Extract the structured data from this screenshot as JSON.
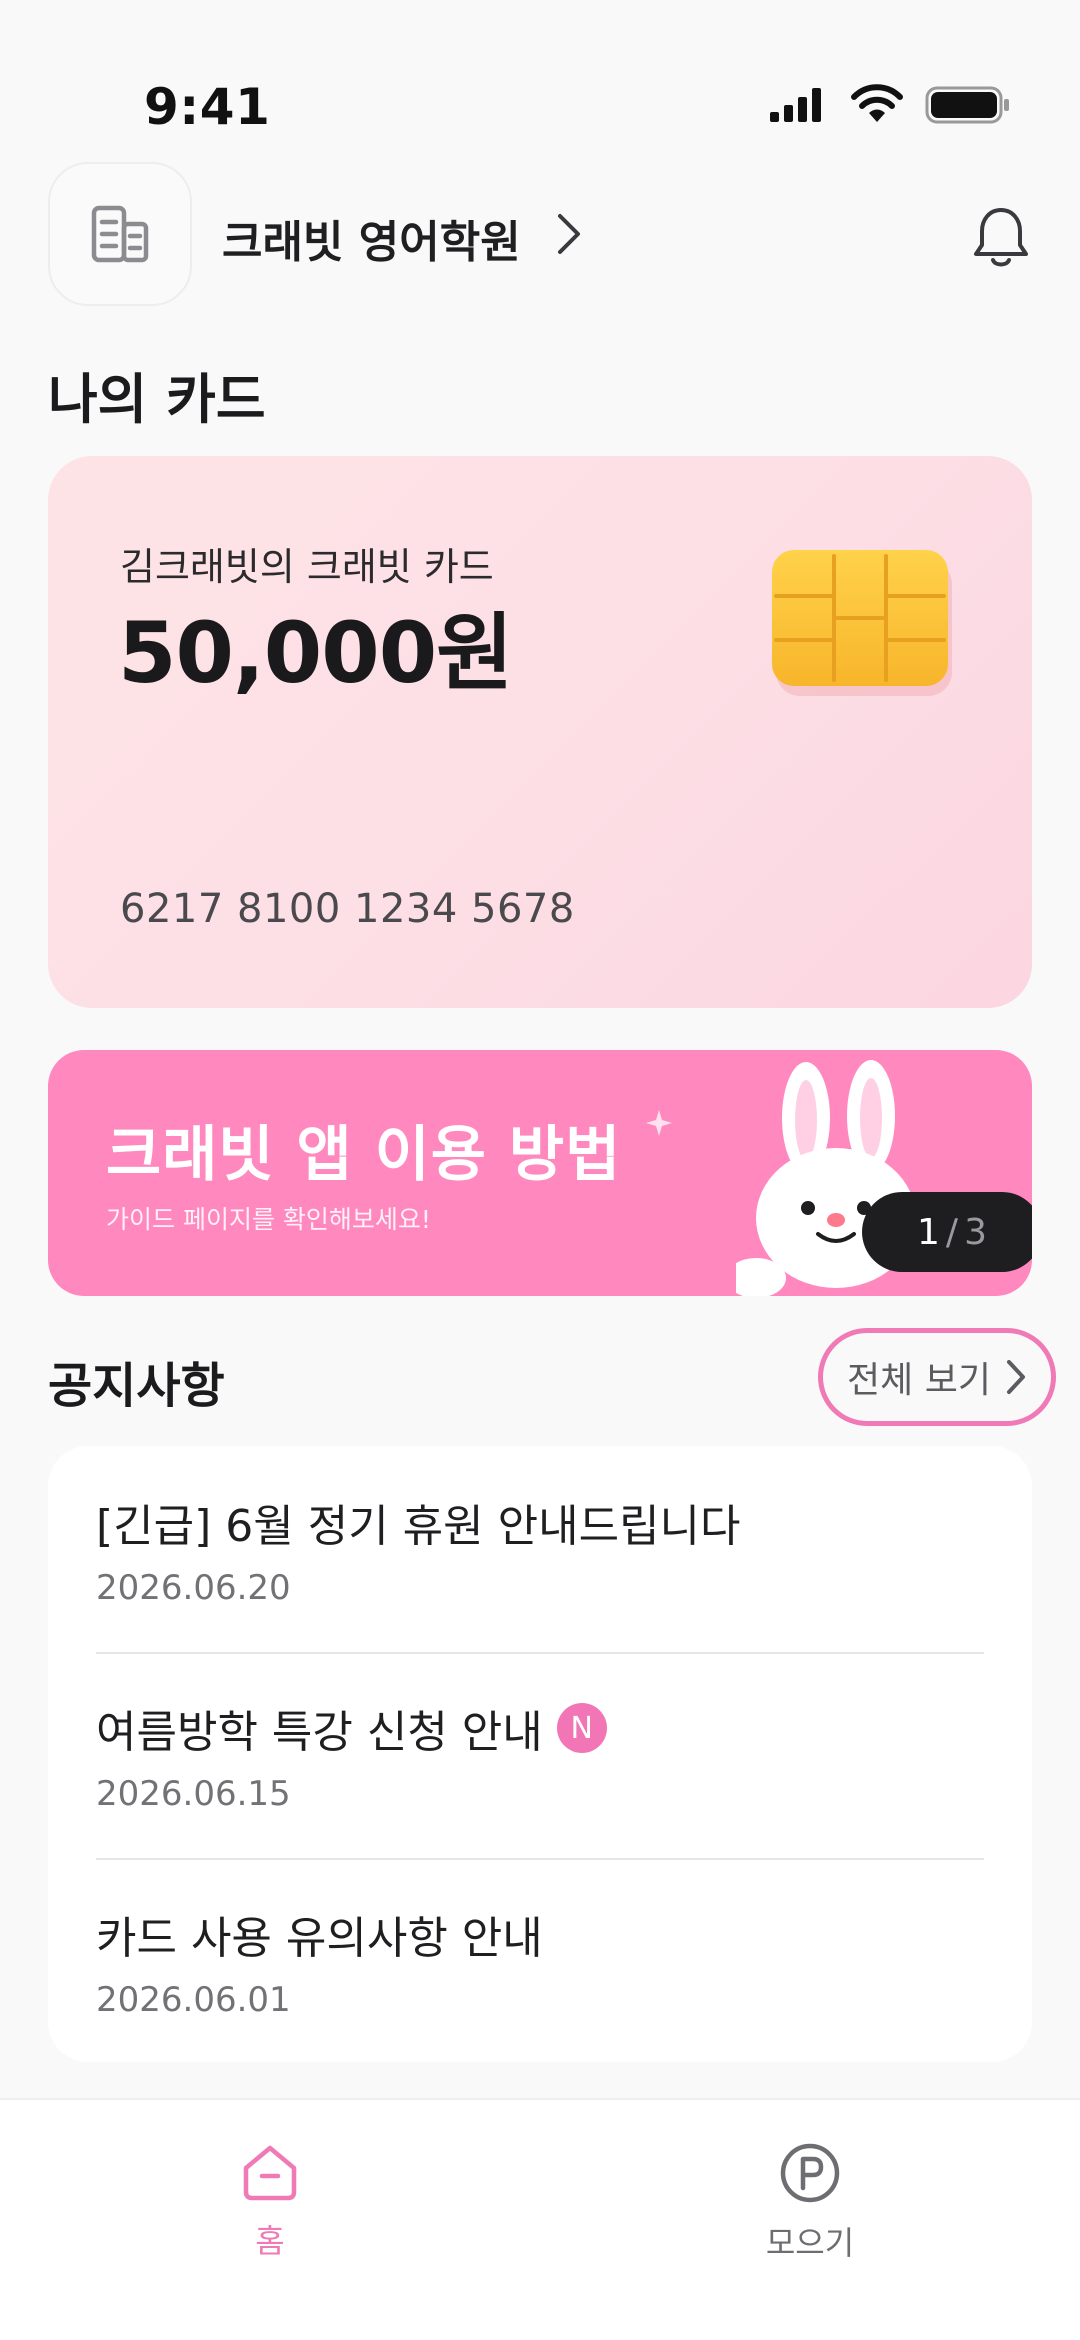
{
  "status_bar": {
    "time": "9:41"
  },
  "header": {
    "academy_name": "크래빗 영어학원"
  },
  "my_card_section": {
    "title": "나의 카드"
  },
  "card": {
    "owner_label": "김크래빗의 크래빗 카드",
    "balance": "50,000원",
    "number": "6217 8100 1234 5678"
  },
  "banner": {
    "title": "크래빗 앱 이용 방법",
    "subtitle": "가이드 페이지를 확인해보세요!",
    "pager_current": "1",
    "pager_separator": "/",
    "pager_total": "3",
    "background_color": "#ff88bf"
  },
  "notices": {
    "title": "공지사항",
    "view_all_label": "전체 보기",
    "items": [
      {
        "title": "[긴급] 6월 정기 휴원 안내드립니다",
        "date": "2026.06.20",
        "is_new": false
      },
      {
        "title": "여름방학 특강 신청 안내",
        "date": "2026.06.15",
        "is_new": true,
        "badge": "N"
      },
      {
        "title": "카드 사용 유의사항 안내",
        "date": "2026.06.01",
        "is_new": false
      }
    ]
  },
  "bottom_nav": {
    "items": [
      {
        "label": "홈",
        "icon": "home-icon",
        "active": true
      },
      {
        "label": "모으기",
        "icon": "points-icon",
        "active": false
      }
    ]
  },
  "colors": {
    "accent": "#f07ab6",
    "card_bg": "#fde2e7"
  }
}
